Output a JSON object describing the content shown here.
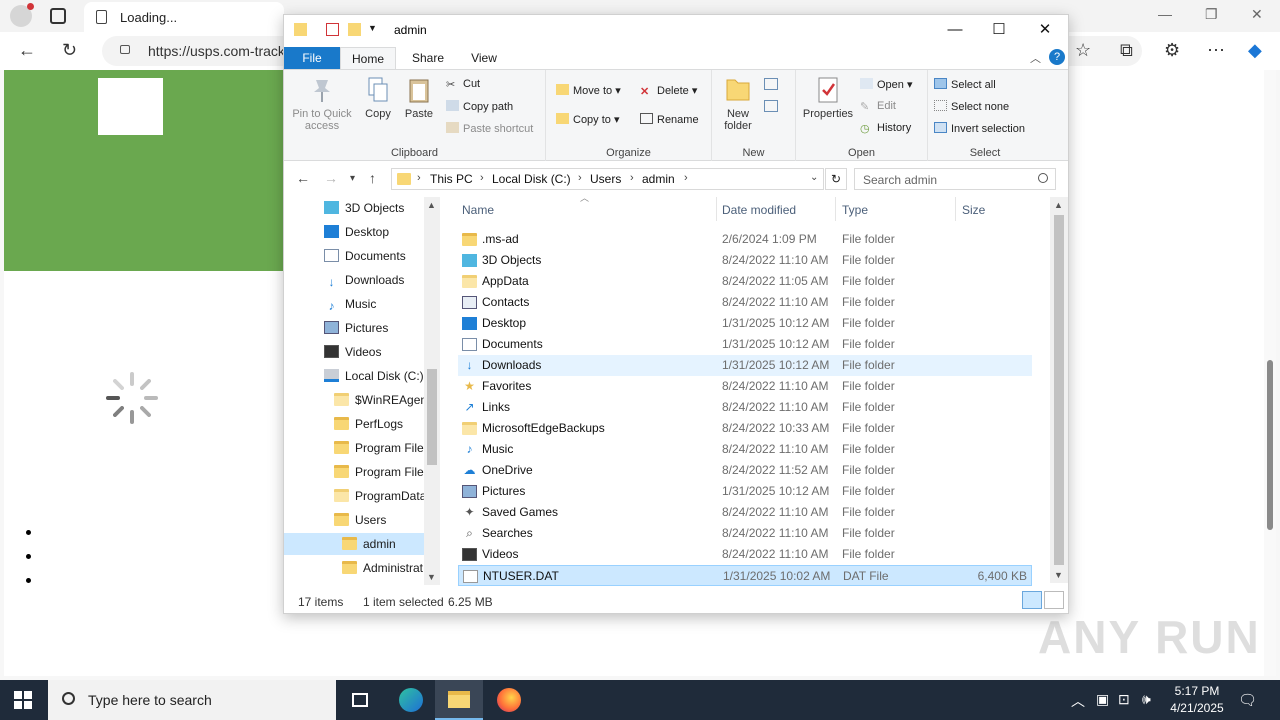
{
  "browser": {
    "tab_title": "Loading...",
    "url": "https://usps.com-track",
    "window_controls": [
      "minimize",
      "restore",
      "close"
    ]
  },
  "explorer": {
    "title": "admin",
    "ribbon_tabs": [
      "File",
      "Home",
      "Share",
      "View"
    ],
    "ribbon": {
      "clipboard": {
        "label": "Clipboard",
        "pin": "Pin to Quick access",
        "copy": "Copy",
        "paste": "Paste",
        "cut": "Cut",
        "copy_path": "Copy path",
        "paste_shortcut": "Paste shortcut"
      },
      "organize": {
        "label": "Organize",
        "move_to": "Move to",
        "copy_to": "Copy to",
        "delete": "Delete",
        "rename": "Rename"
      },
      "new": {
        "label": "New",
        "new_folder": "New folder"
      },
      "open": {
        "label": "Open",
        "properties": "Properties",
        "open": "Open",
        "edit": "Edit",
        "history": "History"
      },
      "select": {
        "label": "Select",
        "select_all": "Select all",
        "select_none": "Select none",
        "invert": "Invert selection"
      }
    },
    "address": {
      "crumbs": [
        "This PC",
        "Local Disk (C:)",
        "Users",
        "admin"
      ],
      "search_placeholder": "Search admin"
    },
    "nav_items": [
      {
        "label": "3D Objects",
        "icon": "cube-icon"
      },
      {
        "label": "Desktop",
        "icon": "desktop-icon"
      },
      {
        "label": "Documents",
        "icon": "documents-icon"
      },
      {
        "label": "Downloads",
        "icon": "download-icon"
      },
      {
        "label": "Music",
        "icon": "music-icon"
      },
      {
        "label": "Pictures",
        "icon": "pictures-icon"
      },
      {
        "label": "Videos",
        "icon": "videos-icon"
      },
      {
        "label": "Local Disk (C:)",
        "icon": "drive-icon"
      },
      {
        "label": "$WinREAgent",
        "icon": "folder-icon"
      },
      {
        "label": "PerfLogs",
        "icon": "folder-icon"
      },
      {
        "label": "Program Files",
        "icon": "folder-icon"
      },
      {
        "label": "Program Files",
        "icon": "folder-icon"
      },
      {
        "label": "ProgramData",
        "icon": "folder-icon"
      },
      {
        "label": "Users",
        "icon": "folder-icon"
      },
      {
        "label": "admin",
        "icon": "folder-icon"
      },
      {
        "label": "Administrat",
        "icon": "folder-icon"
      }
    ],
    "columns": [
      "Name",
      "Date modified",
      "Type",
      "Size"
    ],
    "files": [
      {
        "name": ".ms-ad",
        "date": "2/6/2024 1:09 PM",
        "type": "File folder",
        "size": ""
      },
      {
        "name": "3D Objects",
        "date": "8/24/2022 11:10 AM",
        "type": "File folder",
        "size": ""
      },
      {
        "name": "AppData",
        "date": "8/24/2022 11:05 AM",
        "type": "File folder",
        "size": ""
      },
      {
        "name": "Contacts",
        "date": "8/24/2022 11:10 AM",
        "type": "File folder",
        "size": ""
      },
      {
        "name": "Desktop",
        "date": "1/31/2025 10:12 AM",
        "type": "File folder",
        "size": ""
      },
      {
        "name": "Documents",
        "date": "1/31/2025 10:12 AM",
        "type": "File folder",
        "size": ""
      },
      {
        "name": "Downloads",
        "date": "1/31/2025 10:12 AM",
        "type": "File folder",
        "size": ""
      },
      {
        "name": "Favorites",
        "date": "8/24/2022 11:10 AM",
        "type": "File folder",
        "size": ""
      },
      {
        "name": "Links",
        "date": "8/24/2022 11:10 AM",
        "type": "File folder",
        "size": ""
      },
      {
        "name": "MicrosoftEdgeBackups",
        "date": "8/24/2022 10:33 AM",
        "type": "File folder",
        "size": ""
      },
      {
        "name": "Music",
        "date": "8/24/2022 11:10 AM",
        "type": "File folder",
        "size": ""
      },
      {
        "name": "OneDrive",
        "date": "8/24/2022 11:52 AM",
        "type": "File folder",
        "size": ""
      },
      {
        "name": "Pictures",
        "date": "1/31/2025 10:12 AM",
        "type": "File folder",
        "size": ""
      },
      {
        "name": "Saved Games",
        "date": "8/24/2022 11:10 AM",
        "type": "File folder",
        "size": ""
      },
      {
        "name": "Searches",
        "date": "8/24/2022 11:10 AM",
        "type": "File folder",
        "size": ""
      },
      {
        "name": "Videos",
        "date": "8/24/2022 11:10 AM",
        "type": "File folder",
        "size": ""
      },
      {
        "name": "NTUSER.DAT",
        "date": "1/31/2025 10:02 AM",
        "type": "DAT File",
        "size": "6,400 KB"
      }
    ],
    "status": {
      "count": "17 items",
      "selected": "1 item selected",
      "size": "6.25 MB"
    }
  },
  "watermark": "ANY RUN",
  "taskbar": {
    "search_placeholder": "Type here to search",
    "time": "5:17 PM",
    "date": "4/21/2025"
  },
  "colors": {
    "page_green": "#6aa84f",
    "file_tab": "#1979ca",
    "selection": "#cce8ff",
    "taskbar": "#1f2b3a"
  }
}
